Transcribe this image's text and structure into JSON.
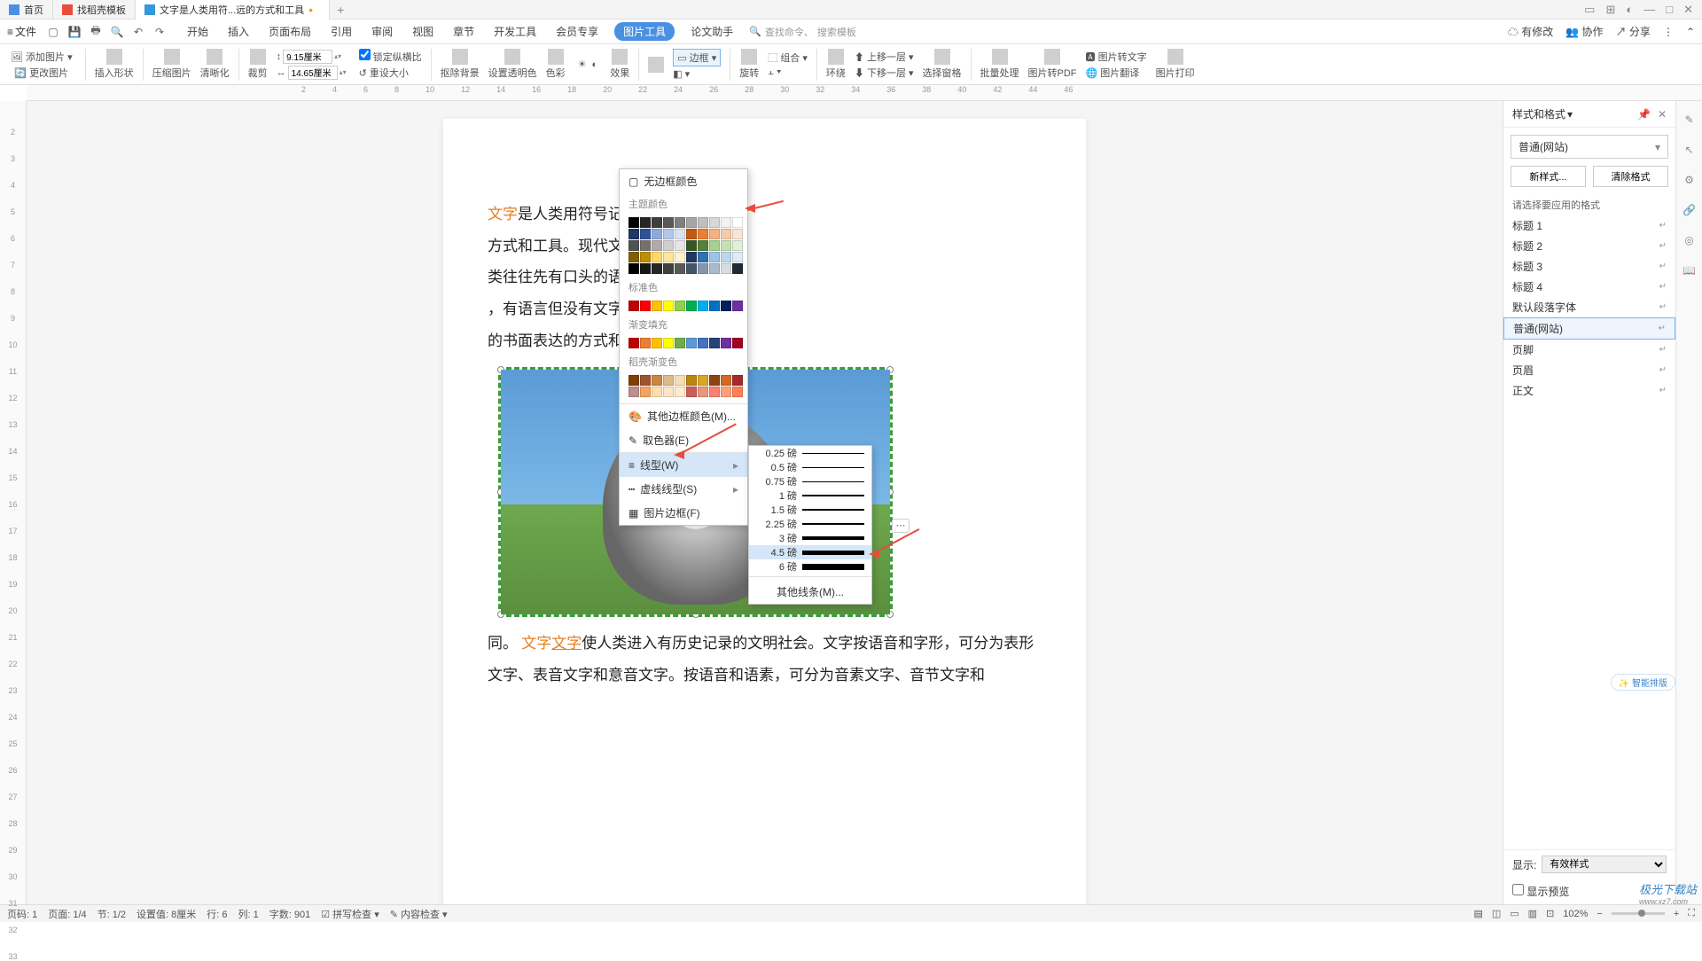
{
  "tabs": [
    {
      "label": "首页",
      "icon": "home"
    },
    {
      "label": "找稻壳模板",
      "icon": "red"
    },
    {
      "label": "文字是人类用符...远的方式和工具",
      "icon": "blue",
      "modified": true
    }
  ],
  "file_menu": "文件",
  "menu": [
    "开始",
    "插入",
    "页面布局",
    "引用",
    "审阅",
    "视图",
    "章节",
    "开发工具",
    "会员专享",
    "图片工具",
    "论文助手"
  ],
  "menu_active_index": 9,
  "search_hint_cmd": "查找命令、",
  "search_hint_tpl": "搜索模板",
  "right_menu": {
    "changes": "有修改",
    "collab": "协作",
    "share": "分享"
  },
  "ribbon": {
    "add_image": "添加图片",
    "change_image": "更改图片",
    "insert_shape": "插入形状",
    "compress": "压缩图片",
    "sharpen": "清晰化",
    "crop": "裁剪",
    "width_label": "9.15厘米",
    "height_label": "14.65厘米",
    "lock_ratio": "锁定纵横比",
    "reset_size": "重设大小",
    "remove_bg": "抠除背景",
    "transparency": "设置透明色",
    "color": "色彩",
    "effect": "效果",
    "border": "边框",
    "rotate": "旋转",
    "combine": "组合",
    "wrap": "环绕",
    "up_layer": "上移一层",
    "down_layer": "下移一层",
    "sel_pane": "选择窗格",
    "batch": "批量处理",
    "to_pdf": "图片转PDF",
    "to_text": "图片转文字",
    "translate": "图片翻译",
    "print": "图片打印"
  },
  "ruler_h": [
    2,
    4,
    6,
    8,
    10,
    12,
    14,
    16,
    18,
    20,
    22,
    24,
    26,
    28,
    30,
    32,
    34,
    36,
    38,
    40,
    42,
    44,
    46
  ],
  "ruler_v": [
    2,
    3,
    4,
    5,
    6,
    7,
    8,
    9,
    10,
    11,
    12,
    13,
    14,
    15,
    16,
    17,
    18,
    19,
    20,
    21,
    22,
    23,
    24,
    25,
    26,
    27,
    28,
    29,
    30,
    31,
    32,
    33
  ],
  "doc": {
    "p1_orange": "文字",
    "p1_rest_a": "是人类用符号记录表达",
    "p1_rest_b": "方式和工具。现代文字大多是记",
    "p1_rest_c": "类往往先有口头的语言后产生书面",
    "p1_rest_d": "，有语言但没有文字。文字的不同",
    "p1_rest_e": "的书面表达的方式和思维不",
    "p2_a": "同。",
    "p2_orange1": "文字",
    "p2_orange2": "文字",
    "p2_b": "使人类进入有历史记录的文明社会。文字按语音和字形，可分为表形文字、表音文字和意音文字。按语音和语素，可分为音素文字、音节文字和"
  },
  "border_dd": {
    "no_border": "无边框颜色",
    "theme": "主题颜色",
    "standard": "标准色",
    "gradient": "渐变填充",
    "dkgrad": "稻壳渐变色",
    "more": "其他边框颜色(M)...",
    "picker": "取色器(E)",
    "line_type": "线型(W)",
    "dash_type": "虚线线型(S)",
    "pic_border": "图片边框(F)"
  },
  "weight_dd": {
    "items": [
      "0.25 磅",
      "0.5 磅",
      "0.75 磅",
      "1 磅",
      "1.5 磅",
      "2.25 磅",
      "3 磅",
      "4.5 磅",
      "6 磅"
    ],
    "selected_index": 7,
    "more": "其他线条(M)..."
  },
  "side": {
    "title": "样式和格式",
    "current": "普通(网站)",
    "btn_new": "新样式...",
    "btn_clear": "清除格式",
    "apply_label": "请选择要应用的格式",
    "items": [
      "标题 1",
      "标题 2",
      "标题 3",
      "标题 4",
      "默认段落字体",
      "普通(网站)",
      "页脚",
      "页眉",
      "正文"
    ],
    "selected_index": 5,
    "show_label": "显示:",
    "show_value": "有效样式",
    "preview": "显示预览"
  },
  "status": {
    "page": "页码: 1",
    "pages": "页面: 1/4",
    "sect": "节: 1/2",
    "pos": "设置值: 8厘米",
    "row": "行: 6",
    "col": "列: 1",
    "words": "字数: 901",
    "spell": "拼写检查",
    "content": "内容检查",
    "zoom": "102%"
  },
  "ai_badge": "智能排版",
  "watermark_main": "极光下载站",
  "watermark_sub": "www.xz7.com",
  "theme_colors": [
    "#000000",
    "#262626",
    "#3f3f3f",
    "#595959",
    "#7f7f7f",
    "#a5a5a5",
    "#bfbfbf",
    "#d8d8d8",
    "#f2f2f2",
    "#ffffff",
    "#1f3864",
    "#2f5496",
    "#8eaadb",
    "#b4c6e7",
    "#d9e2f3",
    "#c45911",
    "#ed7d31",
    "#f4b183",
    "#f7caac",
    "#fbe4d5",
    "#525252",
    "#767171",
    "#afabab",
    "#d0cece",
    "#e7e6e6",
    "#385623",
    "#538135",
    "#a8d08d",
    "#c5e0b3",
    "#e2efd9",
    "#806000",
    "#bf8f00",
    "#ffd966",
    "#ffe599",
    "#fff2cc",
    "#1f3864",
    "#2e74b5",
    "#9cc2e5",
    "#bdd6ee",
    "#deeaf6",
    "#000000",
    "#171717",
    "#262626",
    "#404040",
    "#595959",
    "#44546a",
    "#8496b0",
    "#adb9ca",
    "#d5dce4",
    "#222a35"
  ],
  "standard_colors": [
    "#c00000",
    "#ff0000",
    "#ffc000",
    "#ffff00",
    "#92d050",
    "#00b050",
    "#00b0f0",
    "#0070c0",
    "#002060",
    "#7030a0"
  ],
  "gradient_colors": [
    "#c00000",
    "#ed7d31",
    "#ffc000",
    "#ffff00",
    "#70ad47",
    "#5b9bd5",
    "#4472c4",
    "#264478",
    "#7030a0",
    "#a50021"
  ],
  "dk_gradients": [
    "#7f3f00",
    "#a0522d",
    "#cd853f",
    "#deb887",
    "#f5deb3",
    "#b8860b",
    "#daa520",
    "#8b4513",
    "#d2691e",
    "#a52a2a",
    "#bc8f8f",
    "#f4a460",
    "#ffdead",
    "#ffe4c4",
    "#ffebcd",
    "#cd5c5c",
    "#e9967a",
    "#fa8072",
    "#ffa07a",
    "#ff7f50"
  ]
}
